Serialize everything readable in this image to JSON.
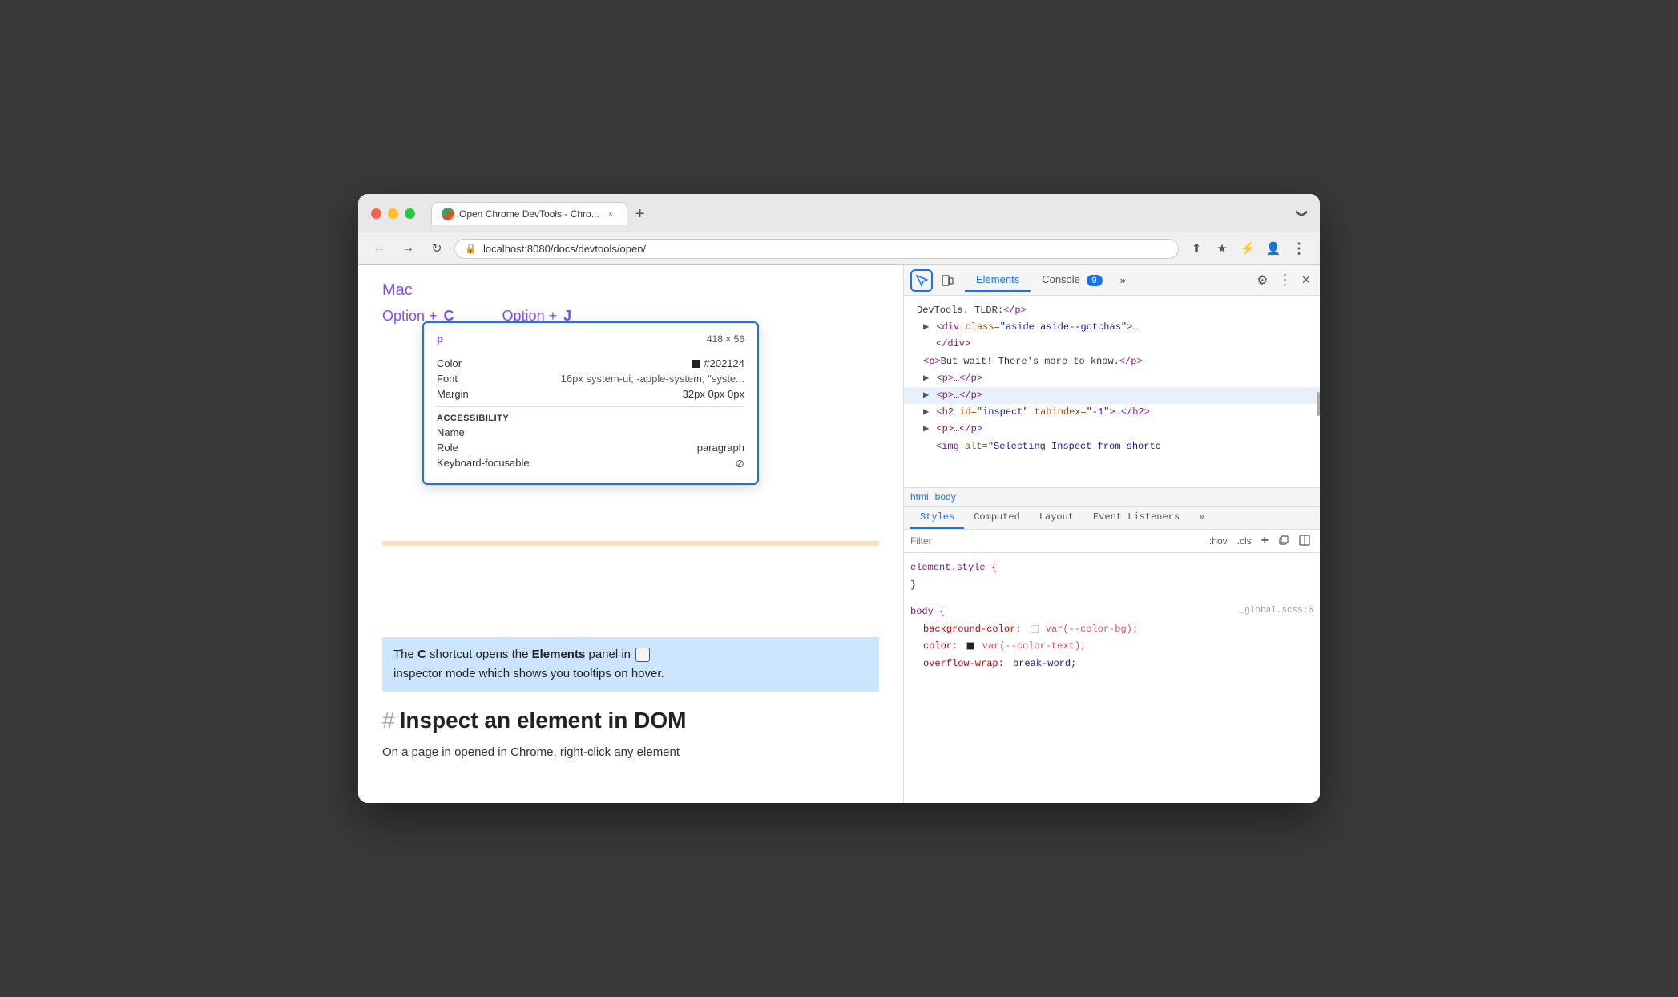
{
  "window": {
    "title": "Open Chrome DevTools - Chro...",
    "tab_label": "Open Chrome DevTools - Chro...",
    "close_btn": "×",
    "new_tab_btn": "+",
    "dropdown_btn": "❯"
  },
  "address_bar": {
    "url": "localhost:8080/docs/devtools/open/",
    "lock_icon": "🔒"
  },
  "page": {
    "mac_label": "Mac",
    "shortcut1_prefix": "Option + ",
    "shortcut1_key": "C",
    "shortcut2_prefix": "Option + ",
    "shortcut2_key": "J",
    "highlighted_text_1": "The ",
    "highlighted_strong_c": "C",
    "highlighted_text_2": " shortcut opens the ",
    "highlighted_strong_elements": "Elements",
    "highlighted_text_3": " panel in",
    "highlighted_text_4": "inspector mode which shows you tooltips on hover.",
    "heading_hash": "#",
    "heading": "Inspect an element in DOM",
    "paragraph": "On a page in opened in Chrome, right-click any element"
  },
  "tooltip": {
    "tag": "p",
    "dimensions": "418 × 56",
    "color_label": "Color",
    "color_value": "#202124",
    "font_label": "Font",
    "font_value": "16px system-ui, -apple-system, \"syste...",
    "margin_label": "Margin",
    "margin_value": "32px 0px 0px",
    "accessibility_label": "ACCESSIBILITY",
    "name_label": "Name",
    "name_value": "",
    "role_label": "Role",
    "role_value": "paragraph",
    "keyboard_label": "Keyboard-focusable",
    "keyboard_value": "⊘"
  },
  "devtools": {
    "inspector_btn": "⬚",
    "device_btn": "□",
    "tab_elements": "Elements",
    "tab_console": "Console",
    "more_tabs": "»",
    "console_badge": "9",
    "gear_icon": "⚙",
    "dots_icon": "⋮",
    "close_icon": "×"
  },
  "dom_tree": {
    "lines": [
      {
        "text": "DevTools. TLDR:</p>",
        "highlighted": false,
        "indent": 0
      },
      {
        "text": "▶ <div class=\"aside aside--gotchas\">…",
        "highlighted": false,
        "indent": 1
      },
      {
        "text": "</div>",
        "highlighted": false,
        "indent": 2
      },
      {
        "text": "<p>But wait! There's more to know.</p>",
        "highlighted": false,
        "indent": 1
      },
      {
        "text": "▶ <p>…</p>",
        "highlighted": false,
        "indent": 1
      },
      {
        "text": "▶ <p>…</p>",
        "highlighted": true,
        "indent": 1
      },
      {
        "text": "▶ <h2 id=\"inspect\" tabindex=\"-1\">…</h2>",
        "highlighted": false,
        "indent": 1
      },
      {
        "text": "▶ <p>…</p>",
        "highlighted": false,
        "indent": 1
      },
      {
        "text": "<img alt=\"Selecting Inspect from shortc",
        "highlighted": false,
        "indent": 2
      }
    ]
  },
  "breadcrumb": {
    "items": [
      "html",
      "body"
    ]
  },
  "styles": {
    "tab_styles": "Styles",
    "tab_computed": "Computed",
    "tab_layout": "Layout",
    "tab_event_listeners": "Event Listeners",
    "more_tabs": "»",
    "filter_placeholder": "Filter",
    "filter_hov": ":hov",
    "filter_cls": ".cls",
    "element_style_selector": "element.style {",
    "element_style_close": "}",
    "body_selector": "body {",
    "body_source": "_global.scss:6",
    "body_prop1": "background-color:",
    "body_val1": "var(--color-bg);",
    "body_prop2": "color:",
    "body_val2": "var(--color-text);",
    "body_prop3": "overflow-wrap:",
    "body_val3": "break-word;"
  },
  "colors": {
    "accent_blue": "#1a73e8",
    "devtools_bg": "#ffffff",
    "highlight_bg": "#e8f0fe",
    "page_highlight": "#cce5ff",
    "purple": "#7c4dff",
    "tooltip_border": "#1a73e8"
  }
}
